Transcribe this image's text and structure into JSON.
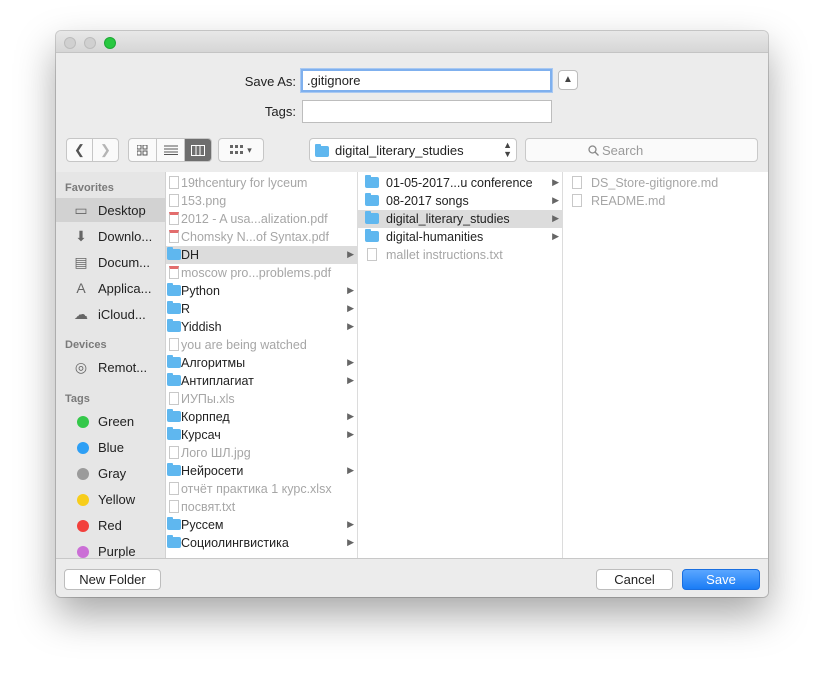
{
  "dialog": {
    "save_as_label": "Save As:",
    "save_as_value": ".gitignore",
    "tags_label": "Tags:",
    "tags_value": "",
    "location": "digital_literary_studies",
    "search_placeholder": "Search"
  },
  "sidebar": {
    "favorites_heading": "Favorites",
    "favorites": [
      {
        "label": "Desktop",
        "icon": "desktop-icon"
      },
      {
        "label": "Downlo...",
        "icon": "download-icon"
      },
      {
        "label": "Docum...",
        "icon": "document-icon"
      },
      {
        "label": "Applica...",
        "icon": "applications-icon"
      },
      {
        "label": "iCloud...",
        "icon": "cloud-icon"
      }
    ],
    "devices_heading": "Devices",
    "devices": [
      {
        "label": "Remot...",
        "icon": "disc-icon"
      }
    ],
    "tags_heading": "Tags",
    "tags": [
      {
        "label": "Green",
        "color": "#34c84a"
      },
      {
        "label": "Blue",
        "color": "#2d9ff5"
      },
      {
        "label": "Gray",
        "color": "#9b9b9b"
      },
      {
        "label": "Yellow",
        "color": "#f7cd1b"
      },
      {
        "label": "Red",
        "color": "#f2403c"
      },
      {
        "label": "Purple",
        "color": "#cb6fd6"
      }
    ]
  },
  "columns": {
    "col1": [
      {
        "label": "19thcentury for lyceum"
      },
      {
        "label": "153.png"
      },
      {
        "label": "2012 - A usa...alization.pdf"
      },
      {
        "label": "Chomsky N...of Syntax.pdf"
      },
      {
        "label": "DH"
      },
      {
        "label": "moscow pro...problems.pdf"
      },
      {
        "label": "Python"
      },
      {
        "label": "R"
      },
      {
        "label": "Yiddish"
      },
      {
        "label": "you are being watched"
      },
      {
        "label": "Алгоритмы"
      },
      {
        "label": "Антиплагиат"
      },
      {
        "label": "ИУПы.xls"
      },
      {
        "label": "Корппед"
      },
      {
        "label": "Курсач"
      },
      {
        "label": "Лого ШЛ.jpg"
      },
      {
        "label": "Нейросети"
      },
      {
        "label": "отчёт практика 1 курс.xlsx"
      },
      {
        "label": "посвят.txt"
      },
      {
        "label": "Руссем"
      },
      {
        "label": "Социолингвистика"
      }
    ],
    "col2": [
      {
        "label": "01-05-2017...u conference"
      },
      {
        "label": "08-2017 songs"
      },
      {
        "label": "digital_literary_studies"
      },
      {
        "label": "digital-humanities"
      },
      {
        "label": "mallet instructions.txt"
      }
    ],
    "col3": [
      {
        "label": "DS_Store-gitignore.md"
      },
      {
        "label": "README.md"
      }
    ]
  },
  "buttons": {
    "new_folder": "New Folder",
    "cancel": "Cancel",
    "save": "Save"
  }
}
